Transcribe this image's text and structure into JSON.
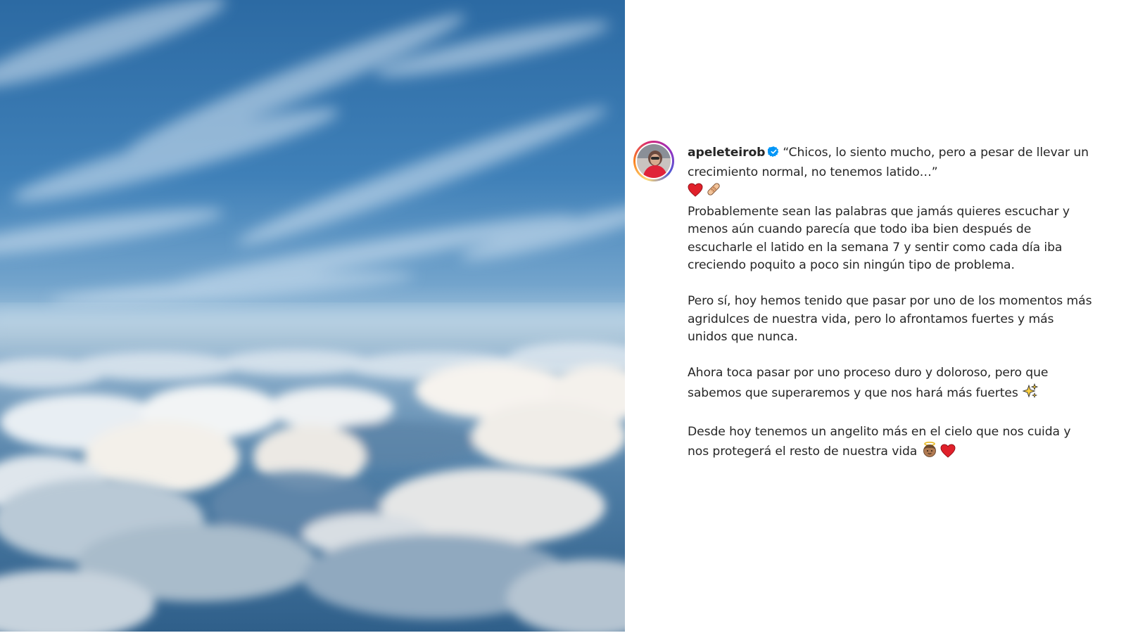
{
  "post": {
    "username": "apeleteirob",
    "quote": "“Chicos, lo siento mucho, pero a pesar de llevar un crecimiento normal, no tenemos latido…”",
    "paragraph_1": "Probablemente sean las palabras que jamás quieres escuchar y menos aún cuando parecía que todo iba bien después de escucharle el latido en la semana 7 y sentir como cada día iba creciendo poquito a poco sin ningún tipo de problema.",
    "paragraph_2": "Pero sí, hoy hemos tenido que pasar por uno de los momentos más agridulces de nuestra vida, pero lo afrontamos fuertes y más unidos que nunca.",
    "paragraph_3": "Ahora toca pasar por uno proceso duro y doloroso, pero que sabemos que superaremos y que nos hará más fuertes",
    "paragraph_4": "Desde hoy tenemos un angelito más en el cielo que nos cuida y nos protegerá el resto de nuestra vida"
  },
  "icons": {
    "verified": "verified-badge-icon",
    "heart": "red-heart-emoji",
    "bandage": "adhesive-bandage-emoji",
    "sparkles": "sparkles-emoji",
    "angel": "baby-angel-emoji"
  },
  "colors": {
    "text": "#262626",
    "verified": "#0095f6",
    "heart": "#e0202a",
    "sky_top": "#2f6fa8",
    "sky_horizon": "#a9c7de"
  }
}
